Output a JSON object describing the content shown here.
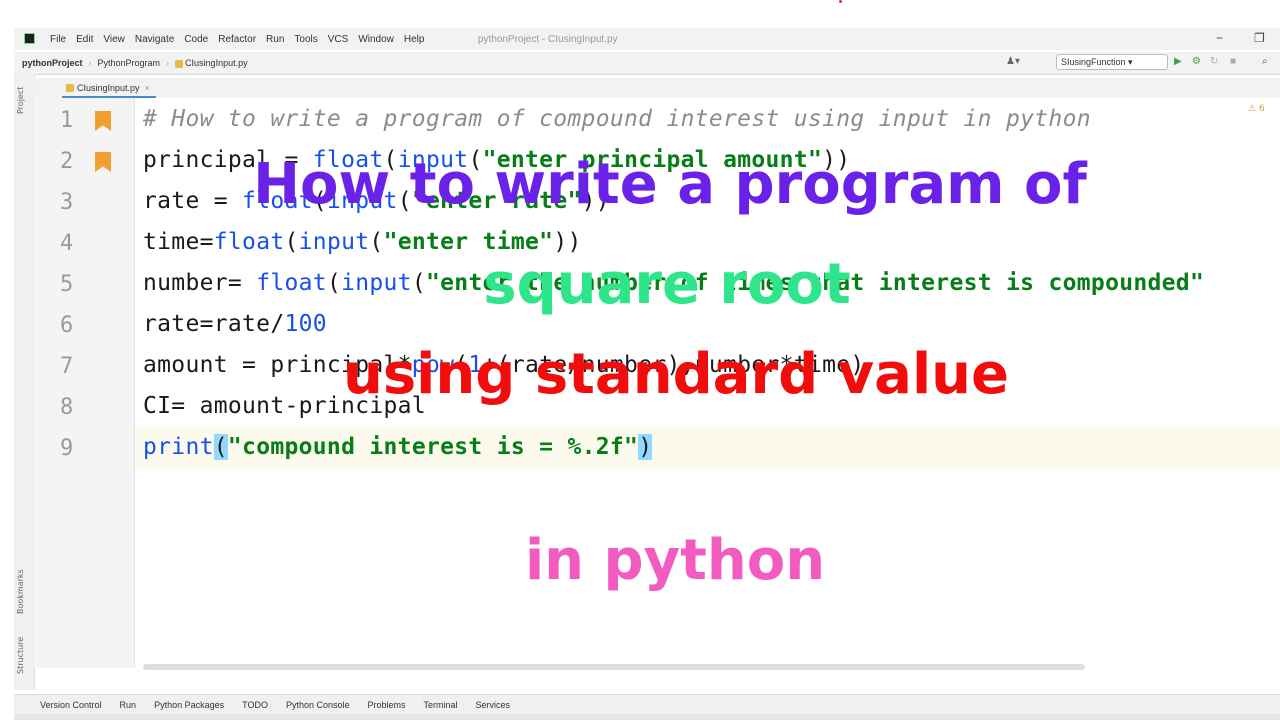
{
  "menubar": {
    "items": [
      "File",
      "Edit",
      "View",
      "Navigate",
      "Code",
      "Refactor",
      "Run",
      "Tools",
      "VCS",
      "Window",
      "Help"
    ],
    "window_title": "pythonProject - CIusingInput.py"
  },
  "navbar": {
    "crumbs": [
      "pythonProject",
      "PythonProgram",
      "CIusingInput.py"
    ],
    "run_config": "SIusingFunction"
  },
  "tab": {
    "label": "CIusingInput.py"
  },
  "editor": {
    "lines": [
      {
        "num": "1",
        "bookmark": true
      },
      {
        "num": "2",
        "bookmark": true
      },
      {
        "num": "3"
      },
      {
        "num": "4"
      },
      {
        "num": "5"
      },
      {
        "num": "6"
      },
      {
        "num": "7"
      },
      {
        "num": "8"
      },
      {
        "num": "9"
      }
    ],
    "warning_count": "6"
  },
  "code": {
    "l1": "# How to write a program of compound interest using input in python",
    "l2a": "principal = ",
    "l2b": "float",
    "l2c": "(",
    "l2d": "input",
    "l2e": "(",
    "l2f": "\"enter principal amount\"",
    "l2g": "))",
    "l3a": "rate = ",
    "l3b": "float",
    "l3c": "(",
    "l3d": "input",
    "l3e": "(",
    "l3f": "\"enter rate\"",
    "l3g": "))",
    "l4a": "time=",
    "l4b": "float",
    "l4c": "(",
    "l4d": "input",
    "l4e": "(",
    "l4f": "\"enter time\"",
    "l4g": "))",
    "l5a": "number= ",
    "l5b": "float",
    "l5c": "(",
    "l5d": "input",
    "l5e": "(",
    "l5f": "\"enter the number of times that interest is compounded\"",
    "l6a": "rate=rate/",
    "l6b": "100",
    "l7a": "amount = principal*",
    "l7b": "pow",
    "l7c": "(",
    "l7d": "1",
    "l7e": "+(rate/number),number*time)",
    "l8": "CI= amount-principal",
    "l9a": "print",
    "l9b": "(",
    "l9c": "\"compound interest is = %.2f\"",
    "l9d": ")"
  },
  "bottombar": {
    "items": [
      "Version Control",
      "Run",
      "Python Packages",
      "TODO",
      "Python Console",
      "Problems",
      "Terminal",
      "Services"
    ]
  },
  "leftstrip": {
    "labels": [
      "Project",
      "Bookmarks",
      "Structure"
    ]
  },
  "overlay": {
    "line1": "How to write a program of",
    "line2": "square root",
    "line3": "using standard value",
    "line4": "in python"
  },
  "colors": {
    "overlay_line1": "#6a21e8",
    "overlay_line2": "#2ee58a",
    "overlay_line3": "#f20d0d",
    "overlay_line4": "#f25bbf",
    "string": "#067d17",
    "builtin": "#1750eb",
    "comment": "#8c8c8c",
    "bookmark": "#f0a030"
  }
}
